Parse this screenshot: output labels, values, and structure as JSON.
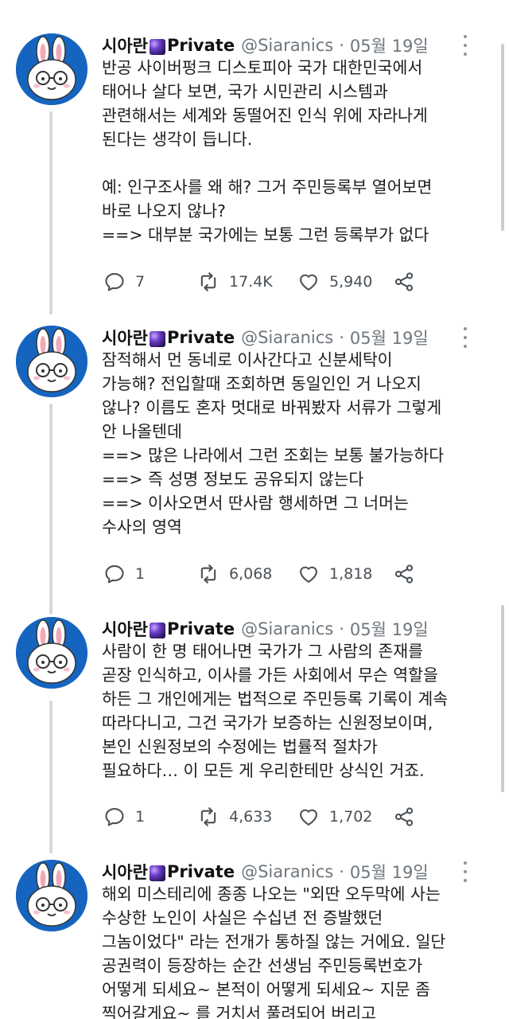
{
  "tweets": [
    {
      "name": "시아란",
      "badge": "Private",
      "handle": "@Siaranics",
      "separator": "·",
      "date": "05월 19일",
      "lines": [
        "반공 사이버펑크 디스토피아 국가 대한민국에서",
        "태어나 살다 보면, 국가 시민관리 시스템과",
        "관련해서는 세계와 동떨어진 인식 위에 자라나게",
        "된다는 생각이 듭니다.",
        "",
        "예: 인구조사를 왜 해? 그거 주민등록부 열어보면",
        "바로 나오지 않나?",
        "==> 대부분 국가에는 보통 그런 등록부가 없다"
      ],
      "replies": "7",
      "retweets": "17.4K",
      "likes": "5,940"
    },
    {
      "name": "시아란",
      "badge": "Private",
      "handle": "@Siaranics",
      "separator": "·",
      "date": "05월 19일",
      "lines": [
        "잠적해서 먼 동네로 이사간다고 신분세탁이",
        "가능해? 전입할때 조회하면 동일인인 거 나오지",
        "않나? 이름도 혼자 멋대로 바꿔봤자 서류가 그렇게",
        "안 나올텐데",
        "==> 많은 나라에서 그런 조회는 보통 불가능하다",
        "==> 즉 성명 정보도 공유되지 않는다",
        "==> 이사오면서 딴사람 행세하면 그 너머는",
        "수사의 영역"
      ],
      "replies": "1",
      "retweets": "6,068",
      "likes": "1,818"
    },
    {
      "name": "시아란",
      "badge": "Private",
      "handle": "@Siaranics",
      "separator": "·",
      "date": "05월 19일",
      "lines": [
        "사람이 한 명 태어나면 국가가 그 사람의 존재를",
        "곧장 인식하고, 이사를 가든 사회에서 무슨 역할을",
        "하든 그 개인에게는 법적으로 주민등록 기록이 계속",
        "따라다니고, 그건 국가가 보증하는 신원정보이며,",
        "본인 신원정보의 수정에는 법률적 절차가",
        "필요하다… 이 모든 게 우리한테만 상식인 거죠."
      ],
      "replies": "1",
      "retweets": "4,633",
      "likes": "1,702"
    },
    {
      "name": "시아란",
      "badge": "Private",
      "handle": "@Siaranics",
      "separator": "·",
      "date": "05월 19일",
      "lines": [
        "해외 미스테리에 종종 나오는 \"외딴 오두막에 사는",
        "수상한 노인이 사실은 수십년 전 증발했던",
        "그놈이었다\" 라는 전개가 통하질 않는 거에요. 일단",
        "공권력이 등장하는 순간 선생님 주민등록번호가",
        "어떻게 되세요~ 본적이 어떻게 되세요~ 지문 좀",
        "찍어갈게요~ 를 거치서 풀려되어 버리고"
      ]
    }
  ],
  "icons": {
    "reply": "reply-icon",
    "retweet": "retweet-icon",
    "like": "heart-icon",
    "share": "share-icon",
    "more": "more-options-icon",
    "avatar": "bunny-avatar-icon"
  },
  "colors": {
    "avatar_bg": "#1565c0",
    "muted": "#6e767d",
    "thread_line": "#d4d9de"
  }
}
